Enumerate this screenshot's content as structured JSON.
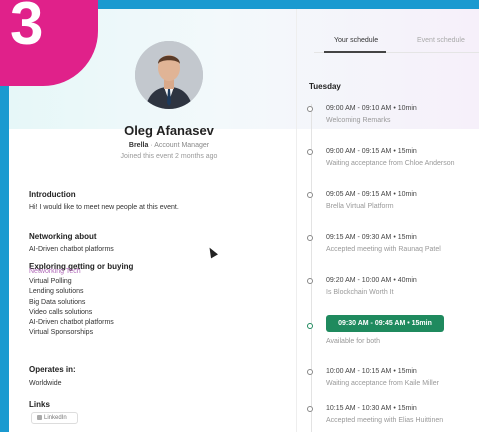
{
  "badge_number": "3",
  "profile": {
    "name": "Oleg Afanasev",
    "company": "Brella",
    "separator": "·",
    "title": "Account Manager",
    "joined": "Joined this event 2 months ago"
  },
  "introduction": {
    "heading": "Introduction",
    "text": "Hi! I would like to meet new people at this event."
  },
  "networking_about": {
    "heading": "Networking about",
    "text": "AI-Driven chatbot platforms"
  },
  "exploring": {
    "heading": "Exploring getting or buying",
    "items": [
      "Networking Tech",
      "Virtual Polling",
      "Lending solutions",
      "Big Data solutions",
      "Video calls solutions",
      "AI-Driven chatbot platforms",
      "Virtual Sponsorships"
    ]
  },
  "operates_in": {
    "heading": "Operates in:",
    "text": "Worldwide"
  },
  "links": {
    "heading": "Links",
    "linkedin": "LinkedIn"
  },
  "tabs": {
    "schedule": "Your schedule",
    "event": "Event schedule"
  },
  "day": "Tuesday",
  "slots": [
    {
      "time": "09:00 AM - 09:10 AM • 10min",
      "sub": "Welcoming Remarks"
    },
    {
      "time": "09:00 AM - 09:15 AM • 15min",
      "sub": "Waiting acceptance from Chloe Anderson"
    },
    {
      "time": "09:05 AM - 09:15 AM • 10min",
      "sub": "Brella Virtual Platform"
    },
    {
      "time": "09:15 AM - 09:30 AM • 15min",
      "sub": "Accepted meeting with Raunaq Patel"
    },
    {
      "time": "09:20 AM - 10:00 AM • 40min",
      "sub": "Is Blockchain Worth It"
    },
    {
      "time": "09:30 AM - 09:45 AM • 15min",
      "sub": "Available for both"
    },
    {
      "time": "10:00 AM - 10:15 AM • 15min",
      "sub": "Waiting acceptance from Kaile Miller"
    },
    {
      "time": "10:15 AM - 10:30 AM • 15min",
      "sub": "Accepted meeting with Elias Huittinen"
    }
  ],
  "colors": {
    "badge": "#e0218a",
    "accent_green": "#1f8a5e",
    "frame_blue": "#1a9ad0",
    "highlight": "#b06ab8"
  }
}
